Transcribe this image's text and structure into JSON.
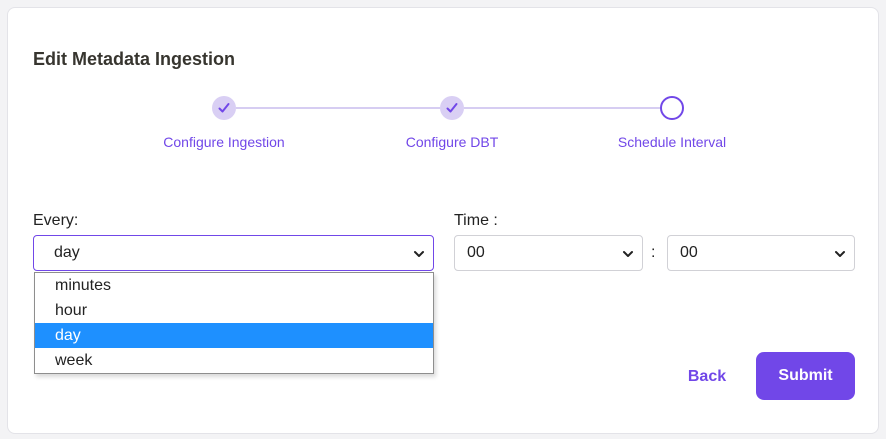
{
  "form": {
    "title": "Edit Metadata Ingestion"
  },
  "stepper": {
    "steps": [
      {
        "label": "Configure Ingestion",
        "status": "completed"
      },
      {
        "label": "Configure DBT",
        "status": "completed"
      },
      {
        "label": "Schedule Interval",
        "status": "active"
      }
    ],
    "accent_color": "#7147e8",
    "completed_color": "#d9cff4"
  },
  "schedule": {
    "every_label": "Every:",
    "every_value": "day",
    "every_options": [
      "minutes",
      "hour",
      "day",
      "week"
    ],
    "time_label": "Time :",
    "hour_value": "00",
    "colon": ":",
    "minute_value": "00"
  },
  "actions": {
    "back_label": "Back",
    "submit_label": "Submit"
  },
  "colors": {
    "primary": "#7147e8",
    "option_highlight": "#1e90ff"
  }
}
